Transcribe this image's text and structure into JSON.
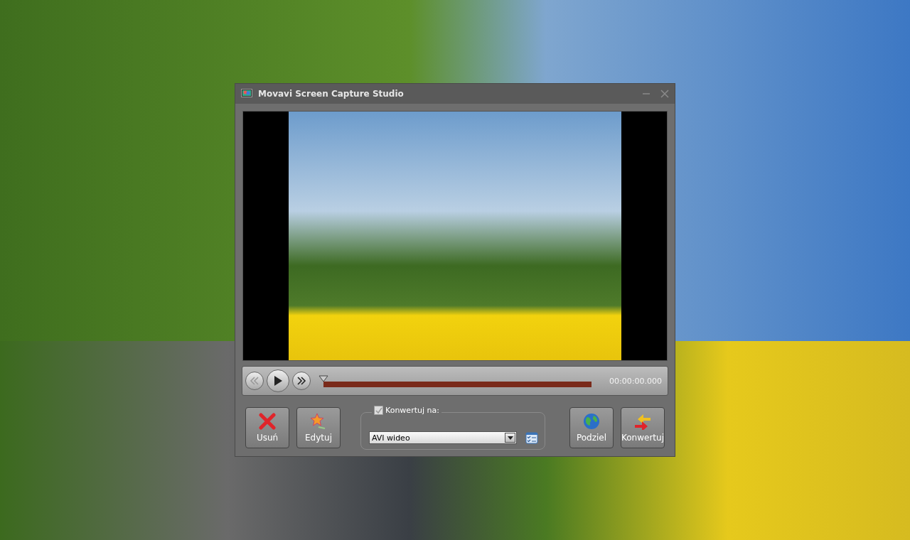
{
  "window": {
    "title": "Movavi Screen Capture Studio"
  },
  "player": {
    "seek": {
      "level": 0
    },
    "time": "00:00:00.000"
  },
  "actions_left": [
    {
      "kind": "delete",
      "label": "Usuń"
    },
    {
      "kind": "edit",
      "label": "Edytuj"
    }
  ],
  "convert": {
    "label": "Konwertuj na:",
    "checked": true,
    "format": "AVI wideo"
  },
  "actions_right": [
    {
      "kind": "share",
      "label": "Podziel"
    },
    {
      "kind": "convert",
      "label": "Konwertuj"
    }
  ]
}
